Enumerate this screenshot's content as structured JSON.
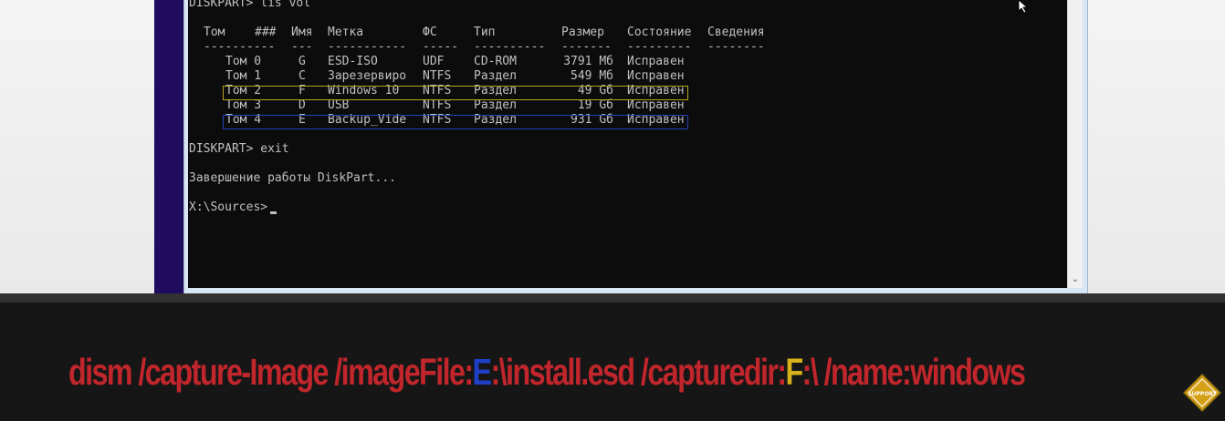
{
  "console": {
    "prompt_lisvol": "DISKPART> lis vol",
    "headers": {
      "tom": "Том",
      "num": "###",
      "name": "Имя",
      "label": "Метка",
      "fs": "ФС",
      "type": "Тип",
      "size": "Размер",
      "status": "Состояние",
      "info": "Сведения"
    },
    "separators": {
      "tom": "----------",
      "name": "---",
      "label": "-----------",
      "fs": "-----",
      "type": "----------",
      "size": "-------",
      "status": "---------",
      "info": "--------"
    },
    "volumes": [
      {
        "tom": "Том 0",
        "name": "G",
        "label": "ESD-ISO",
        "fs": "UDF",
        "type": "CD-ROM",
        "size": "3791 Мб",
        "status": "Исправен"
      },
      {
        "tom": "Том 1",
        "name": "C",
        "label": "Зарезервиро",
        "fs": "NTFS",
        "type": "Раздел",
        "size": "549 Мб",
        "status": "Исправен"
      },
      {
        "tom": "Том 2",
        "name": "F",
        "label": "Windows 10",
        "fs": "NTFS",
        "type": "Раздел",
        "size": "49 Gб",
        "status": "Исправен"
      },
      {
        "tom": "Том 3",
        "name": "D",
        "label": "USB",
        "fs": "NTFS",
        "type": "Раздел",
        "size": "19 Gб",
        "status": "Исправен"
      },
      {
        "tom": "Том 4",
        "name": "E",
        "label": "Backup_Vide",
        "fs": "NTFS",
        "type": "Раздел",
        "size": "931 Gб",
        "status": "Исправен"
      }
    ],
    "prompt_exit": "DISKPART> exit",
    "exit_message": "Завершение работы DiskPart...",
    "final_prompt": "X:\\Sources>"
  },
  "banner": {
    "part1": "dism /capture-Image /imageFile:",
    "drive_e": "E",
    "part2": ":\\install.esd /capturedir:",
    "drive_f": "F",
    "part3": ":\\ /name:windows"
  },
  "logo": {
    "text": "SUPPORT"
  },
  "colors": {
    "banner_text": "#c0262b",
    "drive_e": "#1f3fc9",
    "drive_f": "#d6b11c",
    "console_bg": "#0c0c0c",
    "console_text": "#c0c0c0",
    "highlight_yellow": "#b5a21b",
    "highlight_blue": "#2244b8"
  },
  "icons": {
    "pointer": "mouse-pointer-icon",
    "scroll_down": "chevron-down-icon",
    "logo": "support-badge-icon"
  }
}
